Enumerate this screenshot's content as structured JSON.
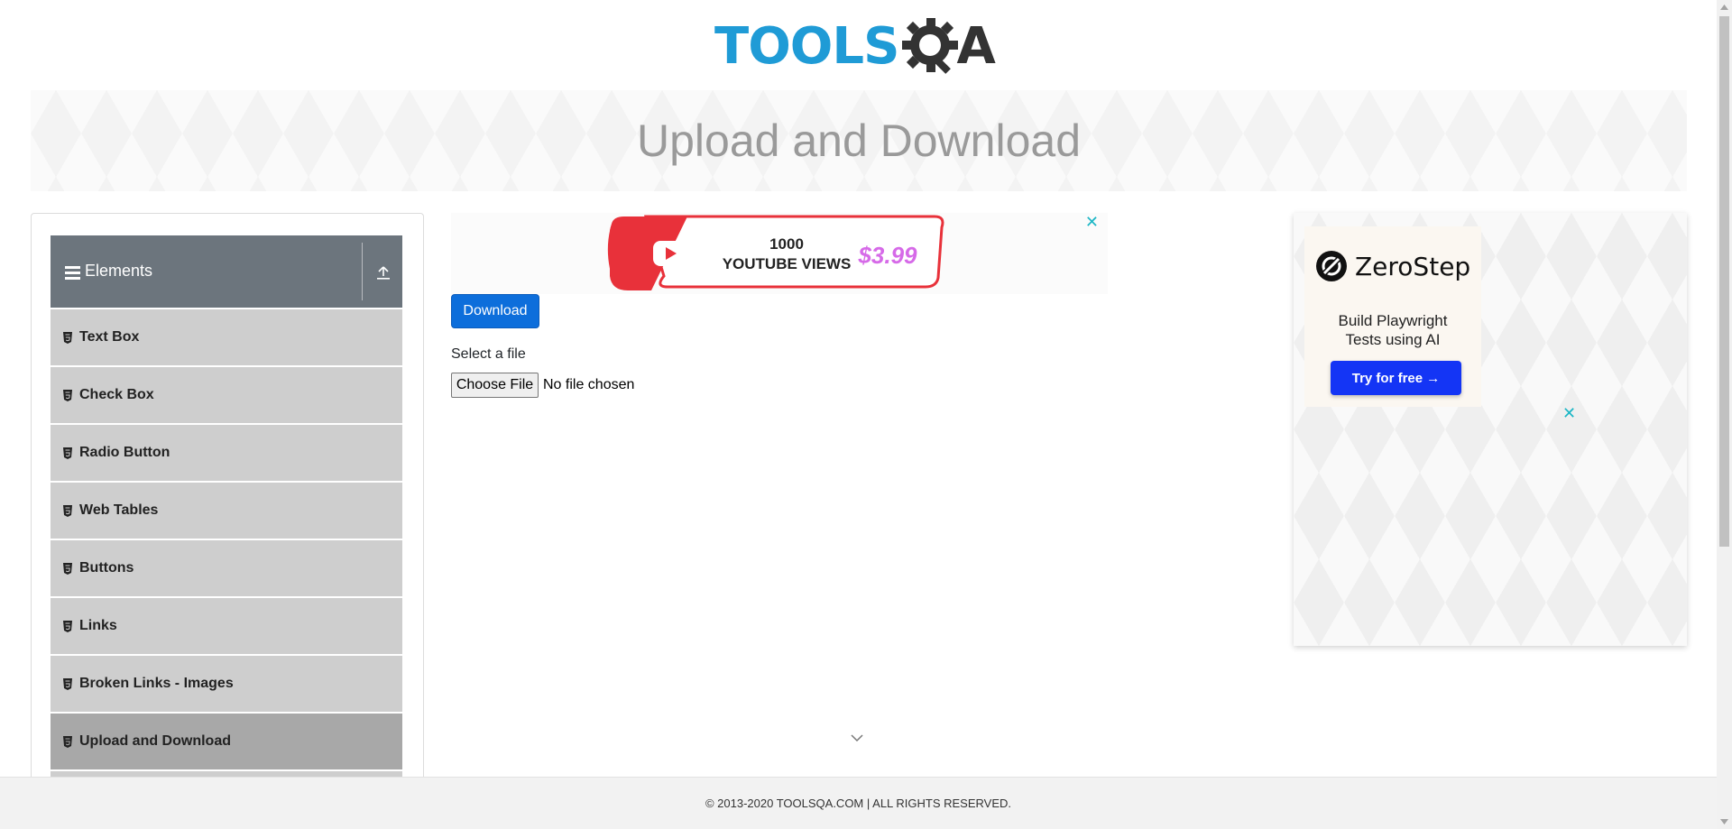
{
  "logo": {
    "part1": "TOOLS",
    "part2": "A"
  },
  "banner": {
    "title": "Upload and Download"
  },
  "sidebar": {
    "group_title": "Elements",
    "items": [
      {
        "label": "Text Box"
      },
      {
        "label": "Check Box"
      },
      {
        "label": "Radio Button"
      },
      {
        "label": "Web Tables"
      },
      {
        "label": "Buttons"
      },
      {
        "label": "Links"
      },
      {
        "label": "Broken Links - Images"
      },
      {
        "label": "Upload and Download"
      }
    ],
    "active_item": "Upload and Download"
  },
  "ad_top": {
    "close": "✕",
    "headline1": "1000",
    "headline2": "YOUTUBE VIEWS",
    "price": "$3.99"
  },
  "main": {
    "download_label": "Download",
    "select_label": "Select a file",
    "choose_file_label": "Choose File",
    "no_file_text": "No file chosen"
  },
  "ad_right": {
    "brand": "ZeroStep",
    "tagline_line1": "Build Playwright",
    "tagline_line2": "Tests using AI",
    "cta": "Try for free →",
    "close": "✕"
  },
  "footer": {
    "text": "© 2013-2020 TOOLSQA.COM | ALL RIGHTS RESERVED."
  },
  "colors": {
    "brand_blue": "#1f9bd6",
    "sidebar_header": "#6c757d",
    "menu_item": "#cecece",
    "menu_item_active": "#a8a8a8",
    "primary_button": "#0d6edb",
    "cta_blue": "#1435f5"
  }
}
